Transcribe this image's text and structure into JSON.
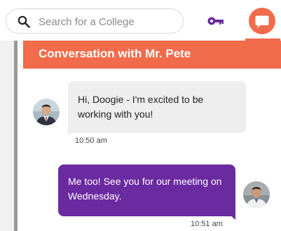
{
  "colors": {
    "accent_orange": "#f26b4a",
    "accent_purple": "#6a2aa0",
    "bubble_gray": "#eeeeee"
  },
  "topbar": {
    "search": {
      "placeholder": "Search for a College",
      "value": "",
      "icon": "search-icon"
    },
    "key_icon": "key-icon",
    "chat_icon": "chat-bubble-icon"
  },
  "conversation": {
    "title": "Conversation with Mr. Pete",
    "messages": [
      {
        "direction": "incoming",
        "text": "Hi, Doogie - I'm excited to be working with you!",
        "time": "10:50 am",
        "avatar": "avatar-mr-pete"
      },
      {
        "direction": "outgoing",
        "text": "Me too! See you for our meeting on Wednesday.",
        "time": "10:51 am",
        "avatar": "avatar-doogie"
      }
    ]
  }
}
